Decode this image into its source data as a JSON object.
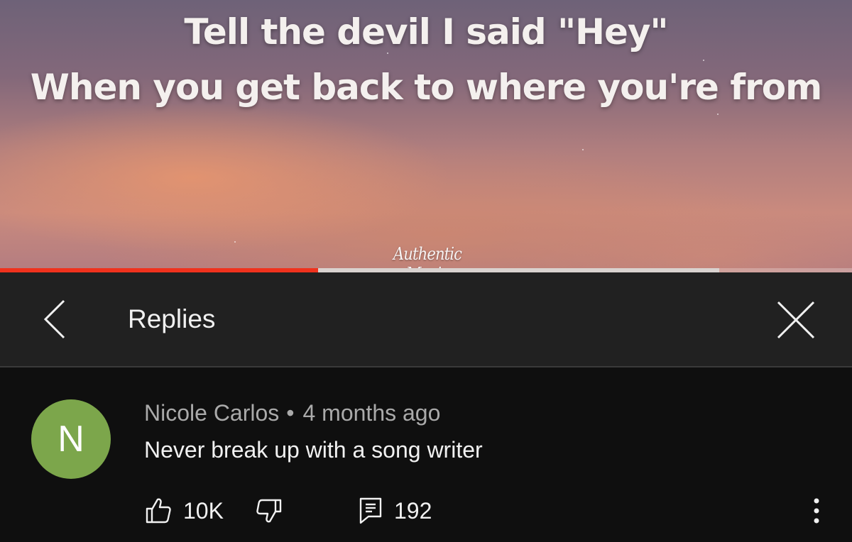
{
  "video": {
    "lyric_line_1": "Tell the devil I said \"Hey\"",
    "lyric_line_2": "When you get back to where you're from",
    "watermark": "Authentic Music",
    "progress_played": 0.373,
    "progress_buffered": 0.844
  },
  "header": {
    "title": "Replies",
    "back_icon": "chevron-left-icon",
    "close_icon": "close-icon"
  },
  "comment": {
    "avatar_letter": "N",
    "avatar_color": "#7ca64b",
    "author": "Nicole Carlos",
    "separator": "•",
    "time": "4 months ago",
    "text": "Never break up with a song writer",
    "likes": "10K",
    "replies": "192",
    "like_icon": "thumbs-up-icon",
    "dislike_icon": "thumbs-down-icon",
    "reply_icon": "comment-icon",
    "more_icon": "more-vert-icon"
  },
  "colors": {
    "progress_played": "#f0321d",
    "background": "#0f0f0f",
    "header_background": "#212121"
  }
}
